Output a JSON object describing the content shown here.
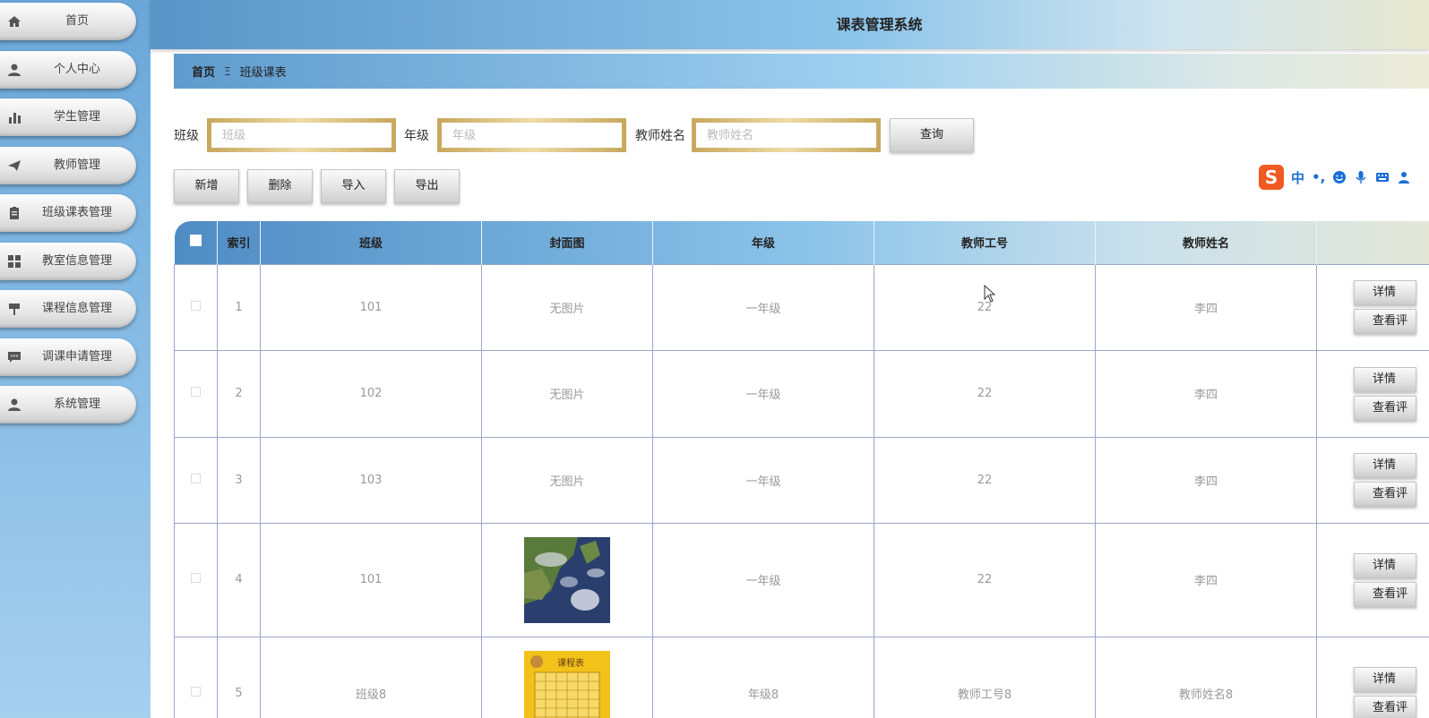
{
  "app_title": "课表管理系统",
  "sidebar": {
    "items": [
      {
        "label": "首页",
        "icon": "home-icon"
      },
      {
        "label": "个人中心",
        "icon": "user-icon"
      },
      {
        "label": "学生管理",
        "icon": "bar-chart-icon"
      },
      {
        "label": "教师管理",
        "icon": "paper-plane-icon"
      },
      {
        "label": "班级课表管理",
        "icon": "clipboard-icon"
      },
      {
        "label": "教室信息管理",
        "icon": "grid-icon"
      },
      {
        "label": "课程信息管理",
        "icon": "podium-icon"
      },
      {
        "label": "调课申请管理",
        "icon": "chat-icon"
      },
      {
        "label": "系统管理",
        "icon": "user-icon"
      }
    ]
  },
  "breadcrumb": {
    "home": "首页",
    "separator": "Ξ",
    "current": "班级课表"
  },
  "search": {
    "class_label": "班级",
    "class_placeholder": "班级",
    "grade_label": "年级",
    "grade_placeholder": "年级",
    "teacher_label": "教师姓名",
    "teacher_placeholder": "教师姓名",
    "query_button": "查询"
  },
  "toolbar": {
    "add": "新增",
    "delete": "删除",
    "import": "导入",
    "export": "导出"
  },
  "ime": {
    "mode": "中",
    "punct": "•,",
    "brand_letter": "S"
  },
  "table": {
    "headers": [
      "索引",
      "班级",
      "封面图",
      "年级",
      "教师工号",
      "教师姓名",
      ""
    ],
    "rows": [
      {
        "index": "1",
        "class": "101",
        "cover": "无图片",
        "grade": "一年级",
        "teacher_id": "22",
        "teacher_name": "李四",
        "detail": "详情",
        "review": "查看评"
      },
      {
        "index": "2",
        "class": "102",
        "cover": "无图片",
        "grade": "一年级",
        "teacher_id": "22",
        "teacher_name": "李四",
        "detail": "详情",
        "review": "查看评"
      },
      {
        "index": "3",
        "class": "103",
        "cover": "无图片",
        "grade": "一年级",
        "teacher_id": "22",
        "teacher_name": "李四",
        "detail": "详情",
        "review": "查看评"
      },
      {
        "index": "4",
        "class": "101",
        "cover": "",
        "grade": "一年级",
        "teacher_id": "22",
        "teacher_name": "李四",
        "detail": "详情",
        "review": "查看评"
      },
      {
        "index": "5",
        "class": "班级8",
        "cover": "",
        "grade": "年级8",
        "teacher_id": "教师工号8",
        "teacher_name": "教师姓名8",
        "detail": "详情",
        "review": "查看评"
      }
    ],
    "cover4_title": "",
    "cover5_title": "课程表"
  }
}
